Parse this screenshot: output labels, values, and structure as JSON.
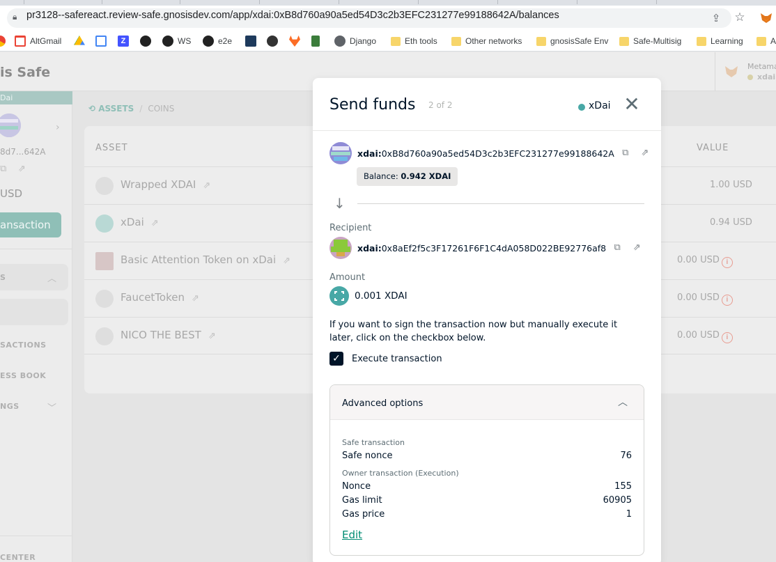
{
  "browser": {
    "url": "pr3128--safereact.review-safe.gnosisdev.com/app/xdai:0xB8d760a90a5ed54D3c2b3EFC231277e99188642A/balances",
    "bookmarks": [
      {
        "label": "",
        "icon": "chrome-icon"
      },
      {
        "label": "AltGmail",
        "icon": "gmail-icon"
      },
      {
        "label": "",
        "icon": "drive-icon"
      },
      {
        "label": "",
        "icon": "calendar-icon"
      },
      {
        "label": "",
        "icon": "z-icon"
      },
      {
        "label": "",
        "icon": "github-icon"
      },
      {
        "label": "WS",
        "icon": "github-icon"
      },
      {
        "label": "e2e",
        "icon": "github-icon"
      },
      {
        "label": "",
        "icon": "app-icon"
      },
      {
        "label": "",
        "icon": "link-icon"
      },
      {
        "label": "",
        "icon": "gitlab-icon"
      },
      {
        "label": "",
        "icon": "book-icon"
      },
      {
        "label": "Django",
        "icon": "globe-icon"
      },
      {
        "label": "Eth tools",
        "icon": "folder-icon"
      },
      {
        "label": "Other networks",
        "icon": "folder-icon"
      },
      {
        "label": "gnosisSafe Env",
        "icon": "folder-icon"
      },
      {
        "label": "Safe-Multisig",
        "icon": "folder-icon"
      },
      {
        "label": "Learning",
        "icon": "folder-icon"
      },
      {
        "label": "A",
        "icon": "folder-icon"
      }
    ]
  },
  "app": {
    "brand": "is Safe",
    "metamask_label": "Metama",
    "metamask_network": "xdai:",
    "sidebar": {
      "network": "Dai",
      "address": "8d7...642A",
      "balance": "USD",
      "new_tx": "ansaction",
      "assets_label": "S",
      "transactions": "SACTIONS",
      "address_book": "ESS BOOK",
      "settings": "NGS",
      "center": "CENTER"
    },
    "breadcrumb": {
      "assets": "ASSETS",
      "sep": "/",
      "coins": "COINS"
    },
    "table": {
      "col_asset": "ASSET",
      "col_value": "VALUE",
      "rows": [
        {
          "name": "Wrapped XDAI",
          "value": "1.00 USD",
          "info": false
        },
        {
          "name": "xDai",
          "value": "0.94 USD",
          "info": false
        },
        {
          "name": "Basic Attention Token on xDai",
          "value": "0.00 USD",
          "info": true
        },
        {
          "name": "FaucetToken",
          "value": "0.00 USD",
          "info": true
        },
        {
          "name": "NICO THE BEST",
          "value": "0.00 USD",
          "info": true
        }
      ]
    }
  },
  "modal": {
    "title": "Send funds",
    "step": "2 of 2",
    "network": "xDai",
    "network_color": "#48a8a6",
    "sender": {
      "prefix": "xdai:",
      "address": "0xB8d760a90a5ed54D3c2b3EFC231277e99188642A"
    },
    "balance_label": "Balance:",
    "balance_value": "0.942 XDAI",
    "recipient_label": "Recipient",
    "recipient": {
      "prefix": "xdai:",
      "address": "0x8aEf2f5c3F17261F6F1C4dA058D022BE92776af8"
    },
    "amount_label": "Amount",
    "amount": "0.001 XDAI",
    "hint": "If you want to sign the transaction now but manually execute it later, click on the checkbox below.",
    "execute_label": "Execute transaction",
    "execute_checked": true,
    "advanced": {
      "title": "Advanced options",
      "safe_section": "Safe transaction",
      "safe_nonce_label": "Safe nonce",
      "safe_nonce": "76",
      "owner_section": "Owner transaction (Execution)",
      "nonce_label": "Nonce",
      "nonce": "155",
      "gas_limit_label": "Gas limit",
      "gas_limit": "60905",
      "gas_price_label": "Gas price",
      "gas_price": "1",
      "edit": "Edit"
    }
  }
}
